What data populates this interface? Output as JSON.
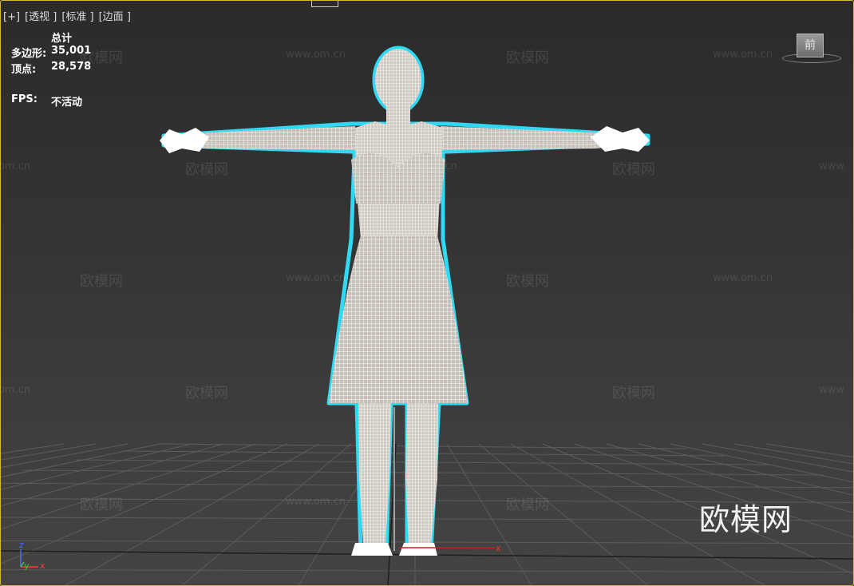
{
  "viewport": {
    "labels": [
      "[+]",
      "[透视 ]",
      "[标准 ]",
      "[边面 ]"
    ]
  },
  "stats": {
    "total_header": "总计",
    "polygons_label": "多边形:",
    "polygons_value": "35,001",
    "vertices_label": "顶点:",
    "vertices_value": "28,578",
    "fps_label": "FPS:",
    "fps_value": "不活动"
  },
  "viewcube": {
    "face_label": "前"
  },
  "axis_tripod": {
    "z": "z",
    "y": "y",
    "x": "x"
  },
  "watermarks": {
    "brand": "欧模网",
    "url": "www.om.cn",
    "url_partial": "om.cn",
    "url_partial_right": "www."
  },
  "gizmo": {
    "x_label": "x"
  },
  "colors": {
    "viewport_border": "#d8b63a",
    "selection_outline": "#2fe3ff",
    "wire": "#ffffff",
    "grid": "#5c5c5c"
  }
}
